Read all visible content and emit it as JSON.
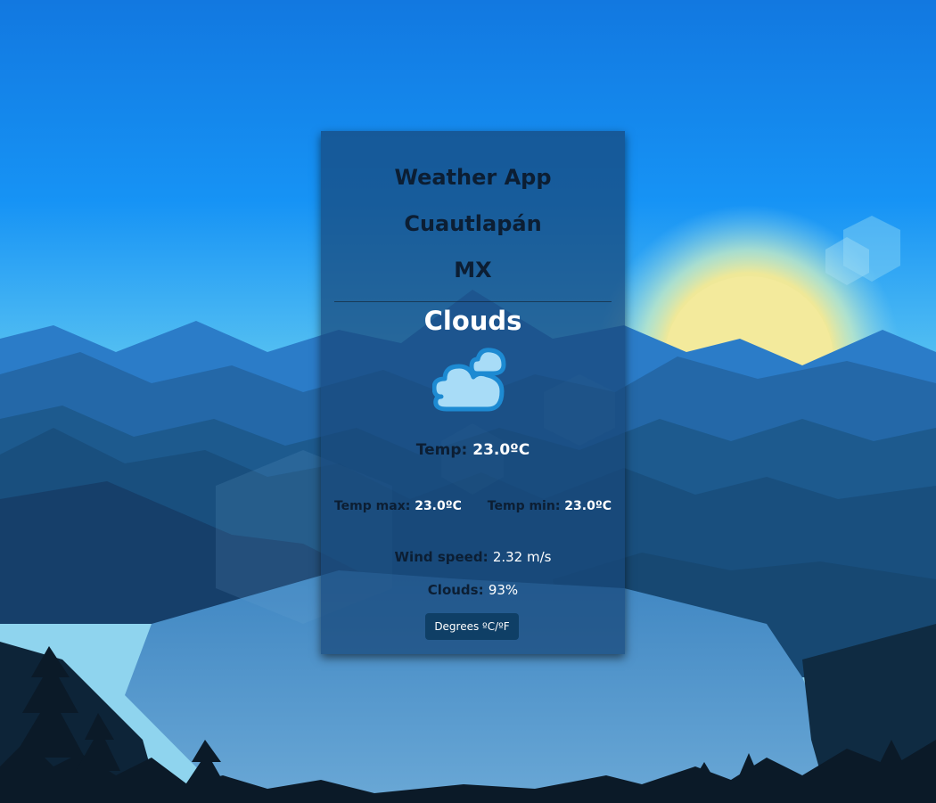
{
  "app": {
    "title": "Weather App",
    "city": "Cuautlapán",
    "country": "MX",
    "description": "Clouds",
    "icon": "clouds-icon"
  },
  "stats": {
    "temp_label": "Temp:",
    "temp_value": "23.0ºC",
    "temp_max_label": "Temp max:",
    "temp_max_value": "23.0ºC",
    "temp_min_label": "Temp min:",
    "temp_min_value": "23.0ºC",
    "wind_label": "Wind speed:",
    "wind_value": "2.32 m/s",
    "clouds_label": "Clouds:",
    "clouds_value": "93%"
  },
  "controls": {
    "toggle_units_label": "Degrees ºC/ºF"
  },
  "colors": {
    "sky_top": "#1284ea",
    "sky_horizon": "#7fd0f2",
    "sun": "#f4ea9a",
    "card": "#184678",
    "button": "#0f3f66"
  }
}
